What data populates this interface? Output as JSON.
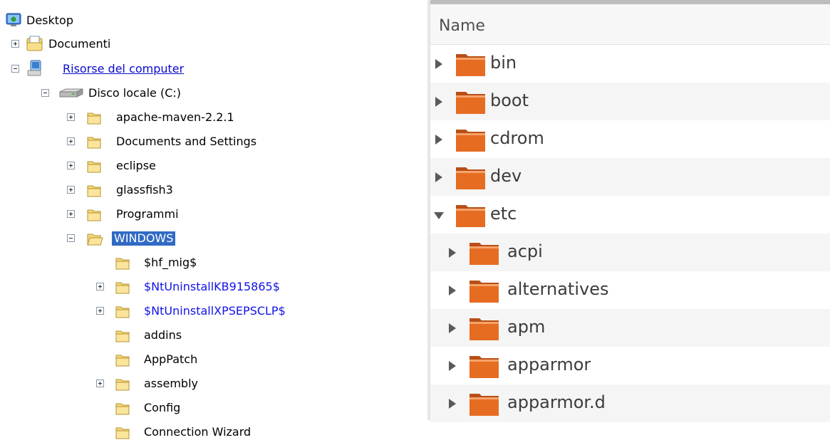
{
  "tree": {
    "desktop": "Desktop",
    "documenti": "Documenti",
    "risorse": "Risorse del computer",
    "disco": "Disco locale (C:)",
    "folders": [
      "apache-maven-2.2.1",
      "Documents and Settings",
      "eclipse",
      "glassfish3",
      "Programmi",
      "WINDOWS"
    ],
    "windows_children": [
      "$hf_mig$",
      "$NtUninstallKB915865$",
      "$NtUninstallXPSEPSCLP$",
      "addins",
      "AppPatch",
      "assembly",
      "Config",
      "Connection Wizard"
    ],
    "selected_color": "#316ac5"
  },
  "list": {
    "column_header": "Name",
    "top_items": [
      "bin",
      "boot",
      "cdrom",
      "dev",
      "etc"
    ],
    "etc_children": [
      "acpi",
      "alternatives",
      "apm",
      "apparmor",
      "apparmor.d"
    ],
    "folder_color": "#e0651e"
  }
}
